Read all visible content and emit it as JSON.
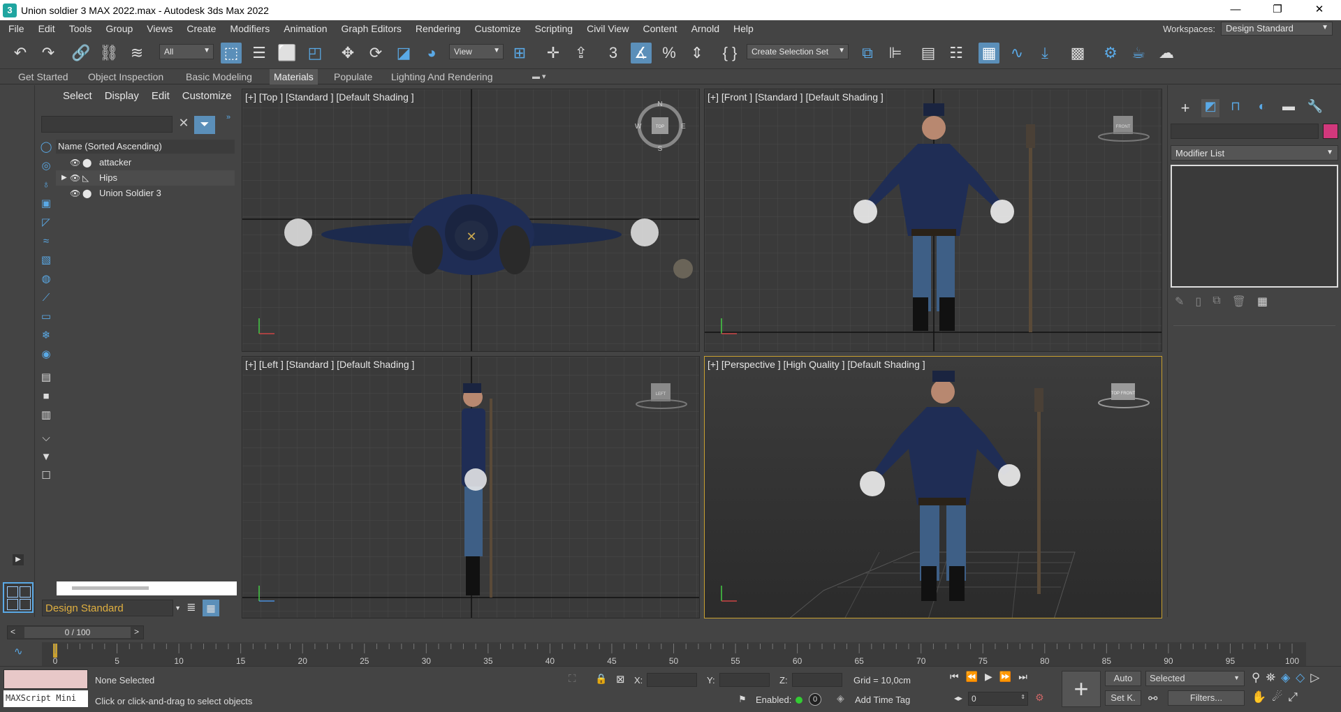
{
  "window": {
    "title": "Union soldier 3 MAX 2022.max - Autodesk 3ds Max 2022",
    "app_icon_glyph": "3",
    "minimize": "—",
    "restore": "❐",
    "close": "✕"
  },
  "menu": [
    "File",
    "Edit",
    "Tools",
    "Group",
    "Views",
    "Create",
    "Modifiers",
    "Animation",
    "Graph Editors",
    "Rendering",
    "Customize",
    "Scripting",
    "Civil View",
    "Content",
    "Arnold",
    "Help"
  ],
  "workspace": {
    "label": "Workspaces:",
    "value": "Design Standard"
  },
  "toolbar": {
    "selection_filter": "All",
    "ref_coord": "View",
    "named_selection": "Create Selection Set"
  },
  "ribbon_tabs": [
    "Get Started",
    "Object Inspection",
    "Basic Modeling",
    "Materials",
    "Populate",
    "Lighting And Rendering"
  ],
  "ribbon_active": "Materials",
  "explorer": {
    "tabs": [
      "Select",
      "Display",
      "Edit",
      "Customize"
    ],
    "column_header": "Name (Sorted Ascending)",
    "rows": [
      {
        "name": "attacker",
        "type_icon": "sphere-icon"
      },
      {
        "name": "Hips",
        "type_icon": "bone-icon",
        "expandable": true
      },
      {
        "name": "Union Soldier 3",
        "type_icon": "sphere-icon"
      }
    ],
    "workspace_select": "Design Standard"
  },
  "viewports": {
    "top": "[+] [Top ] [Standard ] [Default Shading ]",
    "front": "[+] [Front ] [Standard ] [Default Shading ]",
    "left": "[+] [Left ] [Standard ] [Default Shading ]",
    "perspective": "[+] [Perspective ] [High Quality ] [Default Shading ]",
    "viewcube": {
      "n": "N",
      "s": "S",
      "e": "E",
      "w": "W",
      "top": "TOP",
      "front": "FRONT",
      "left": "LEFT",
      "persp": "TOP FRONT"
    }
  },
  "command_panel": {
    "modifier_list": "Modifier List",
    "color_swatch": "#d1387c"
  },
  "timeline": {
    "frame_display": "0 / 100",
    "ticks": [
      "0",
      "5",
      "10",
      "15",
      "20",
      "25",
      "30",
      "35",
      "40",
      "45",
      "50",
      "55",
      "60",
      "65",
      "70",
      "75",
      "80",
      "85",
      "90",
      "95",
      "100"
    ]
  },
  "status": {
    "maxscript": "MAXScript Mini",
    "selection": "None Selected",
    "prompt": "Click or click-and-drag to select objects",
    "x_label": "X:",
    "y_label": "Y:",
    "z_label": "Z:",
    "grid": "Grid = 10,0cm",
    "enabled_label": "Enabled:",
    "add_time_tag": "Add Time Tag",
    "frame_field": "0",
    "auto": "Auto",
    "set_key": "Set K.",
    "key_filter": "Selected",
    "filters": "Filters..."
  }
}
